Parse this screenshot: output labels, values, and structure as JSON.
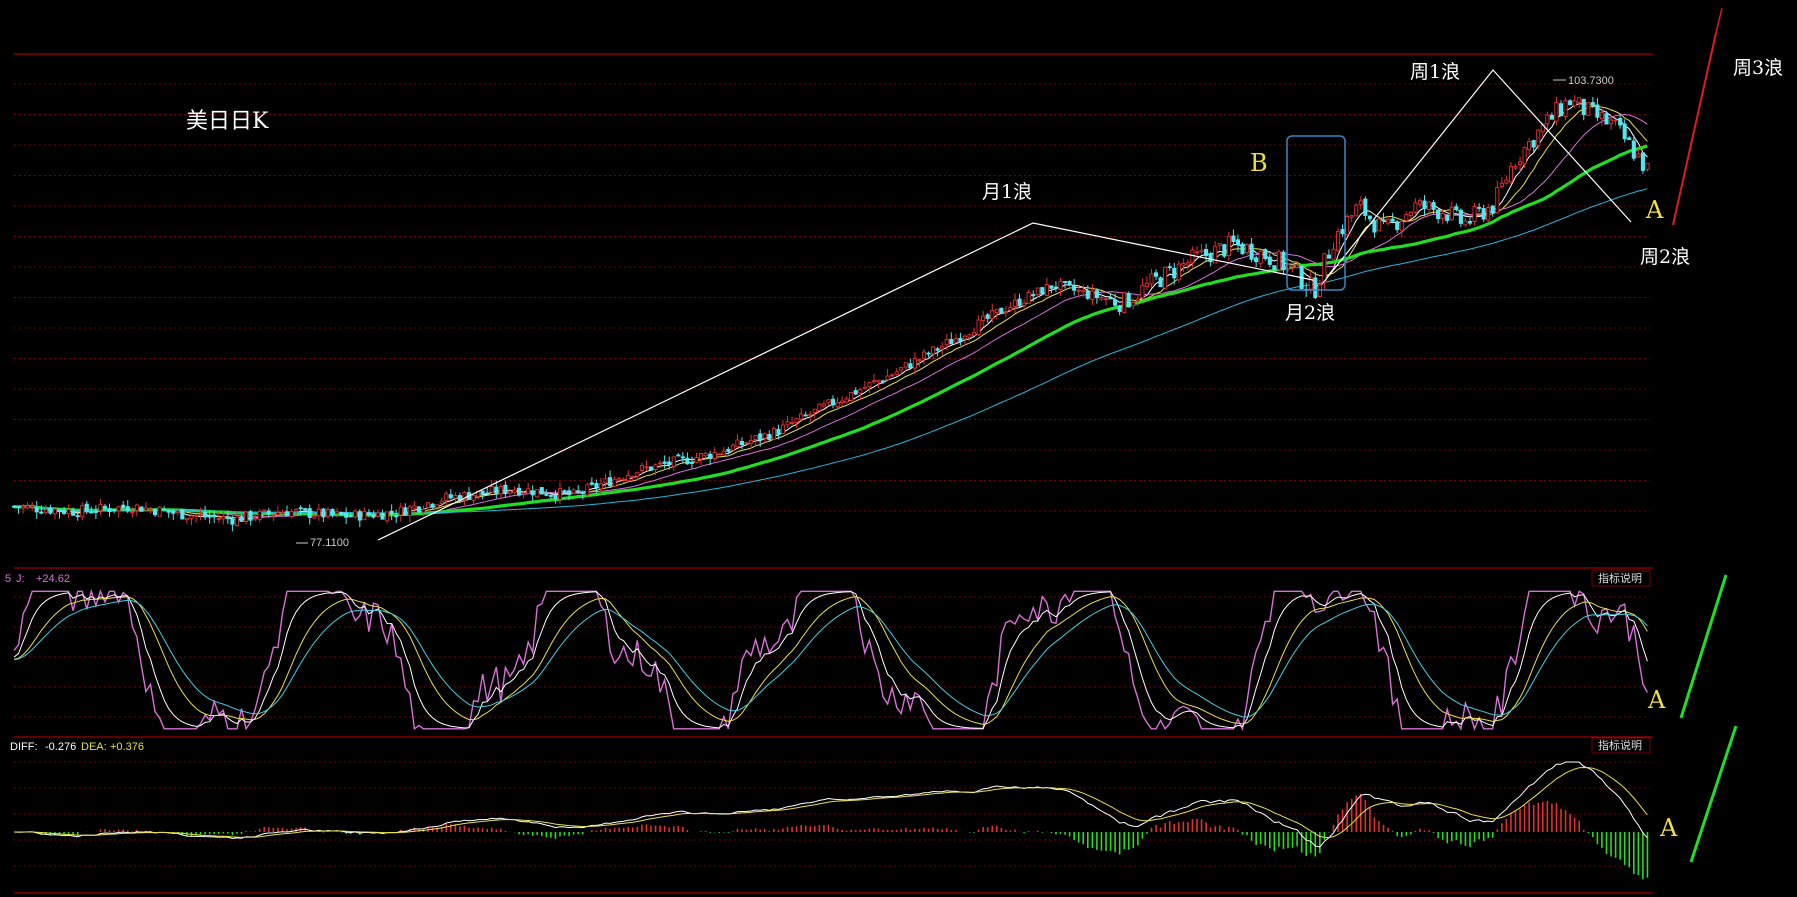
{
  "title": "美日日K",
  "colors": {
    "background": "#000000",
    "grid": "#7a0000",
    "separator": "#c00000",
    "up": "#e03030",
    "down": "#55e6f0",
    "ma_fast": "#ffffff",
    "ma_yellow": "#e8e04a",
    "ma_magenta": "#d870d8",
    "ma_green": "#22dd22",
    "ma_cyan": "#20b8dd",
    "kdj_k": "#ffffff",
    "kdj_d": "#e8e04a",
    "kdj_cyan": "#40d0e0",
    "kdj_j": "#d870d8",
    "annot_white": "#ffffff",
    "annot_yellow": "#f0e040",
    "annot_red": "#dd1c1c",
    "annot_green": "#22dd22",
    "box": "#3a86c8"
  },
  "annotations": {
    "month_wave_1": "月1浪",
    "month_wave_2": "月2浪",
    "week_wave_1": "周1浪",
    "week_wave_2": "周2浪",
    "week_wave_3": "周3浪",
    "label_B": "B",
    "label_A_price": "A",
    "label_A_kdj": "A",
    "label_A_macd": "A"
  },
  "kdj_panel": {
    "header_prefix": "5",
    "j_label": "J: ",
    "j_value": "+24.62",
    "info_button": "指标说明"
  },
  "macd_panel": {
    "diff_label": "DIFF: ",
    "diff_value": "-0.276",
    "dea_label": "DEA: ",
    "dea_value": "+0.376",
    "info_button": "指标说明"
  },
  "chart_data": [
    {
      "type": "candlestick",
      "name": "price",
      "high_label": "103.7300",
      "low_label": "77.1100",
      "high": 103.73,
      "low": 77.11,
      "ylim": [
        75.5,
        106
      ],
      "gridlines": true,
      "trend_note": "flat base, then steady advance from ~77 to ~103.7, then sharp pullback to ~98.6",
      "x_tick_labels": []
    },
    {
      "type": "line",
      "name": "kdj",
      "ylim": [
        -10,
        110
      ],
      "series": [
        {
          "name": "J",
          "last": 24.62
        }
      ]
    },
    {
      "type": "bar",
      "name": "macd",
      "series": [
        {
          "name": "DIFF",
          "last": -0.276
        },
        {
          "name": "DEA",
          "last": 0.376
        }
      ]
    }
  ]
}
